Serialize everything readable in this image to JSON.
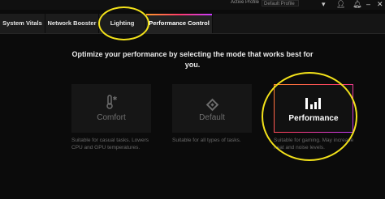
{
  "topbar": {
    "profile_label": "Active Profile",
    "profile_value": "Default Profile",
    "icons": [
      "chevron-down-icon",
      "user-icon",
      "bell-icon",
      "minimize-icon",
      "close-icon"
    ]
  },
  "tabs": [
    {
      "label": "System Vitals",
      "active": false
    },
    {
      "label": "Network Booster",
      "active": false
    },
    {
      "label": "Lighting",
      "active": false
    },
    {
      "label": "Performance Control",
      "active": true
    }
  ],
  "main": {
    "heading": "Optimize your performance by selecting the mode that works best for you.",
    "modes": [
      {
        "label": "Comfort",
        "icon": "thermometer-snowflake-icon",
        "selected": false,
        "description": "Suitable for casual tasks. Lowers CPU and GPU temperatures."
      },
      {
        "label": "Default",
        "icon": "diamond-icon",
        "selected": false,
        "description": "Suitable for all types of tasks."
      },
      {
        "label": "Performance",
        "icon": "performance-bars-icon",
        "selected": true,
        "description": "Suitable for gaming. May increase heat and noise levels."
      }
    ]
  },
  "colors": {
    "background": "#0b0b0b",
    "accent_gradient": [
      "#ff9a2a",
      "#ff3b6a",
      "#c63bff"
    ],
    "annotation": "#f3e21a"
  }
}
